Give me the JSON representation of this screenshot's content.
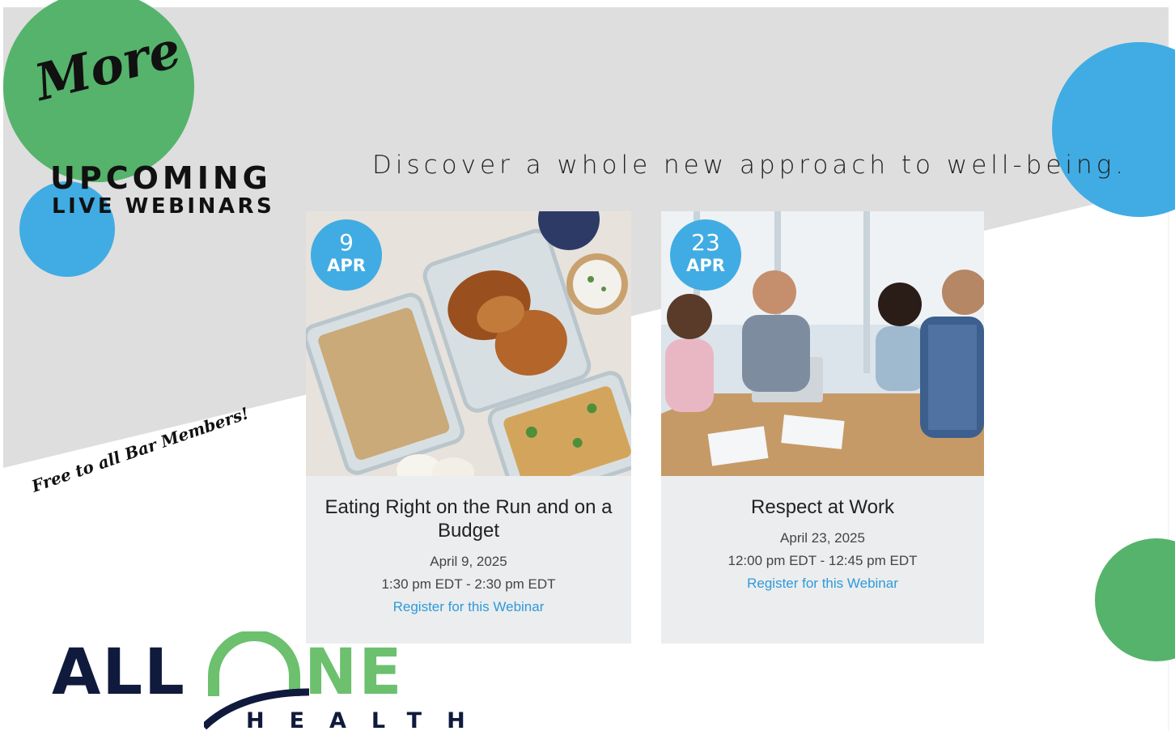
{
  "header": {
    "script_word": "More",
    "heading_line1": "UPCOMING",
    "heading_line2": "LIVE WEBINARS",
    "tagline": "Discover a whole new approach to well-being.",
    "free_note": "Free to all Bar Members!"
  },
  "webinars": [
    {
      "badge_day": "9",
      "badge_month": "APR",
      "image_icon": "food-prep-photo",
      "title": "Eating Right on the Run and on a Budget",
      "date": "April 9, 2025",
      "time": "1:30 pm EDT - 2:30 pm EDT",
      "link": "Register for this Webinar"
    },
    {
      "badge_day": "23",
      "badge_month": "APR",
      "image_icon": "office-meeting-photo",
      "title": "Respect at Work",
      "date": "April 23, 2025",
      "time": "12:00 pm EDT - 12:45 pm EDT",
      "link": "Register for this Webinar"
    }
  ],
  "logo": {
    "part1": "ALL",
    "part2": "NE",
    "sub": "HEALTH"
  },
  "colors": {
    "green": "#55b36c",
    "blue": "#41ace3",
    "gray_band": "#dedede",
    "navy": "#0f1a3d",
    "link": "#2f9ad8"
  }
}
